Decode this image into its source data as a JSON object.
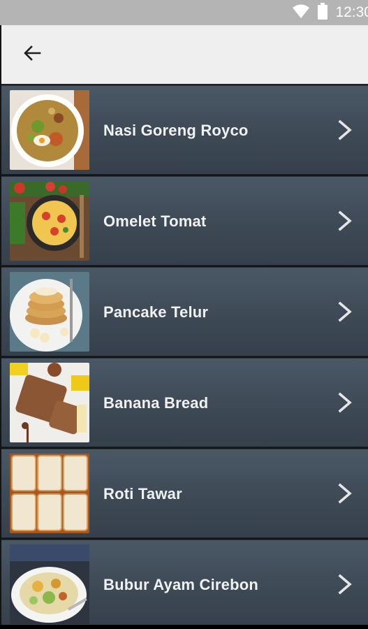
{
  "status_bar": {
    "time": "12:30",
    "icons": [
      "wifi-icon",
      "battery-icon"
    ]
  },
  "app_bar": {
    "back_icon": "arrow-left-icon"
  },
  "recipes": [
    {
      "label": "Nasi Goreng Royco",
      "thumbnail": "fried-rice-photo"
    },
    {
      "label": "Omelet Tomat",
      "thumbnail": "tomato-omelet-photo"
    },
    {
      "label": "Pancake Telur",
      "thumbnail": "pancake-photo"
    },
    {
      "label": "Banana Bread",
      "thumbnail": "banana-bread-photo"
    },
    {
      "label": "Roti Tawar",
      "thumbnail": "white-bread-photo"
    },
    {
      "label": "Bubur Ayam Cirebon",
      "thumbnail": "chicken-porridge-photo"
    }
  ],
  "colors": {
    "status_bar": "#b4b4b4",
    "app_bar": "#efefef",
    "row_background": "#3d4955",
    "row_text": "#f1f1f1"
  }
}
